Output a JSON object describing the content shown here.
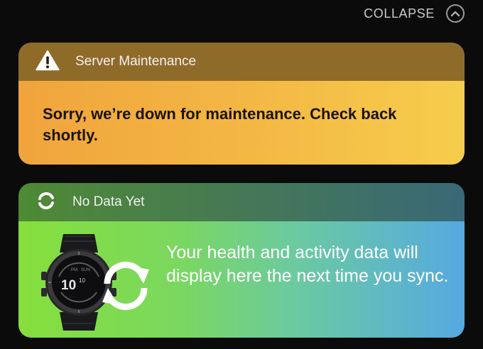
{
  "header": {
    "collapse_label": "COLLAPSE",
    "collapse_icon": "chevron-up-icon"
  },
  "maintenance_card": {
    "icon": "warning-icon",
    "title": "Server Maintenance",
    "message": "Sorry, we’re down for maintenance. Check back shortly.",
    "colors": {
      "header": "#8f6b2a",
      "body_start": "#f0a43c",
      "body_end": "#f6cd4c"
    }
  },
  "nodata_card": {
    "icon": "sync-icon",
    "title": "No Data Yet",
    "message": "Your health and activity data will display here the next time you sync.",
    "watch_display": {
      "hour": "10",
      "minute": "10"
    },
    "colors": {
      "body_start": "#86df3c",
      "body_end": "#55a9e2"
    }
  }
}
